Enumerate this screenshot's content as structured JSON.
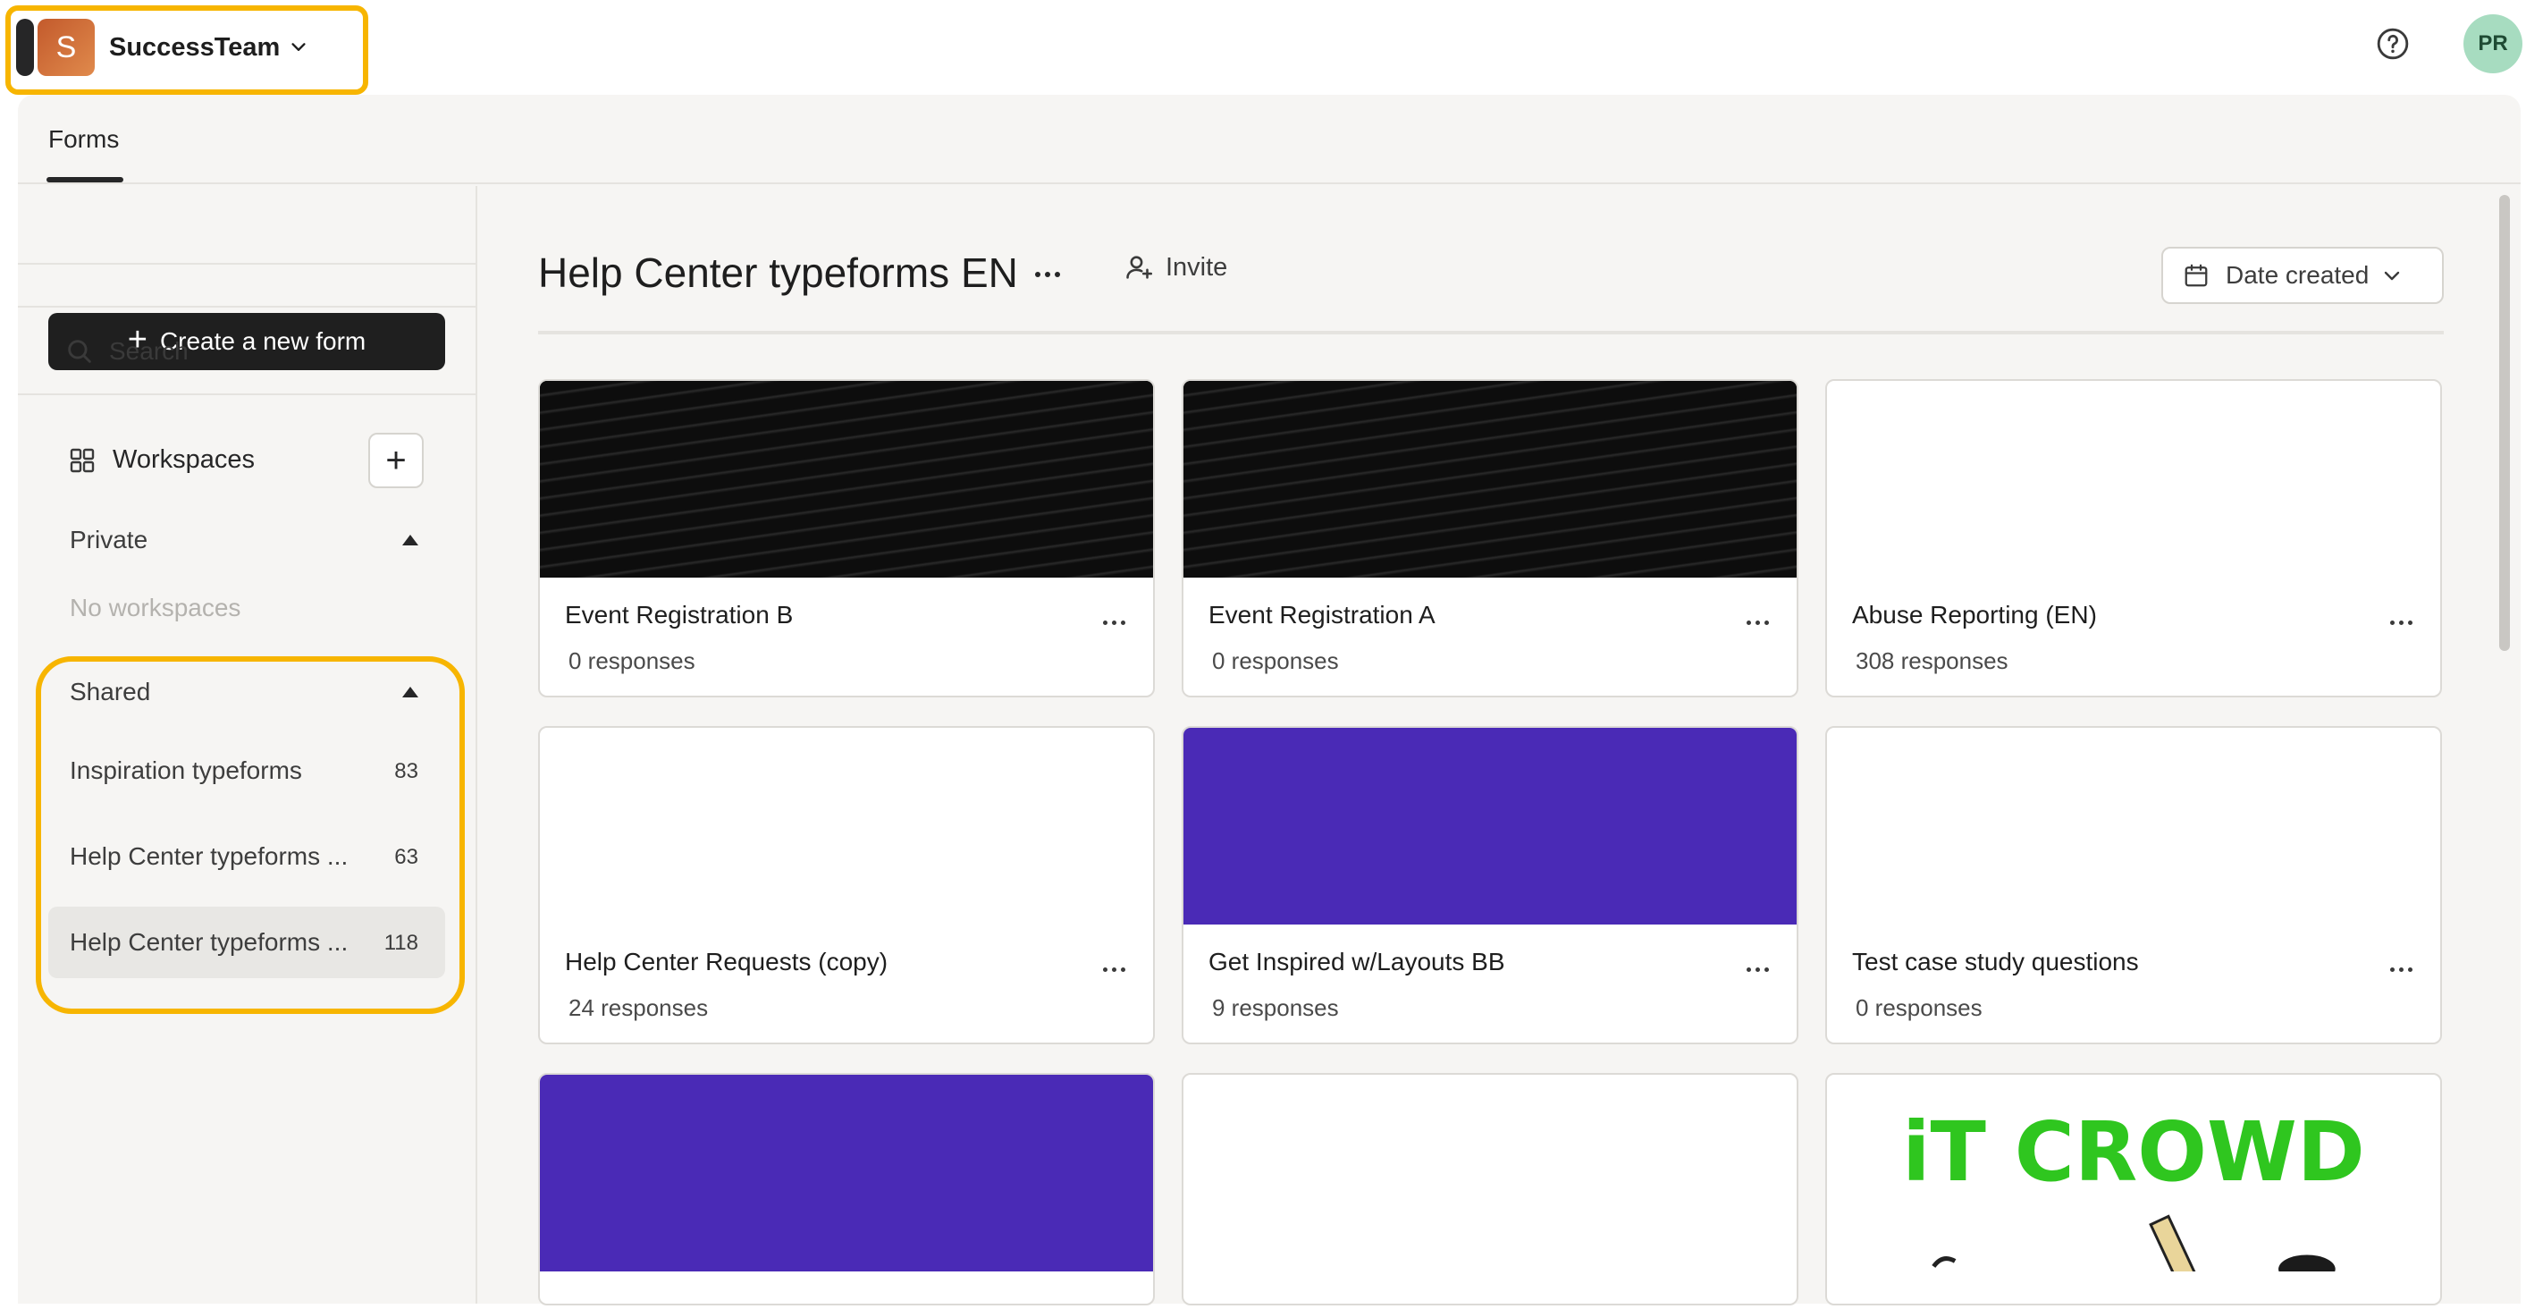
{
  "org": {
    "initial": "S",
    "name": "SuccessTeam"
  },
  "user": {
    "initials": "PR"
  },
  "tabs": {
    "forms": "Forms"
  },
  "sidebar": {
    "create_label": "Create a new form",
    "search_label": "Search",
    "workspaces_label": "Workspaces",
    "private": {
      "title": "Private",
      "empty": "No workspaces"
    },
    "shared": {
      "title": "Shared",
      "items": [
        {
          "name": "Inspiration typeforms",
          "count": "83"
        },
        {
          "name": "Help Center typeforms ...",
          "count": "63"
        },
        {
          "name": "Help Center typeforms ...",
          "count": "118"
        }
      ]
    }
  },
  "content": {
    "title": "Help Center typeforms EN",
    "invite_label": "Invite",
    "sort_label": "Date created",
    "cards": [
      {
        "title": "Event Registration B",
        "responses": "0 responses",
        "cover": "dark"
      },
      {
        "title": "Event Registration A",
        "responses": "0 responses",
        "cover": "dark"
      },
      {
        "title": "Abuse Reporting (EN)",
        "responses": "308 responses",
        "cover": "none"
      },
      {
        "title": "Help Center Requests (copy)",
        "responses": "24 responses",
        "cover": "none"
      },
      {
        "title": "Get Inspired w/Layouts BB",
        "responses": "9 responses",
        "cover": "purple"
      },
      {
        "title": "Test case study questions",
        "responses": "0 responses",
        "cover": "none"
      }
    ],
    "itcrowd_text": "iT CROWD"
  },
  "colors": {
    "accent_highlight": "#f7b500",
    "purple": "#4a2ab6",
    "avatar_green": "#a7dcc0"
  }
}
